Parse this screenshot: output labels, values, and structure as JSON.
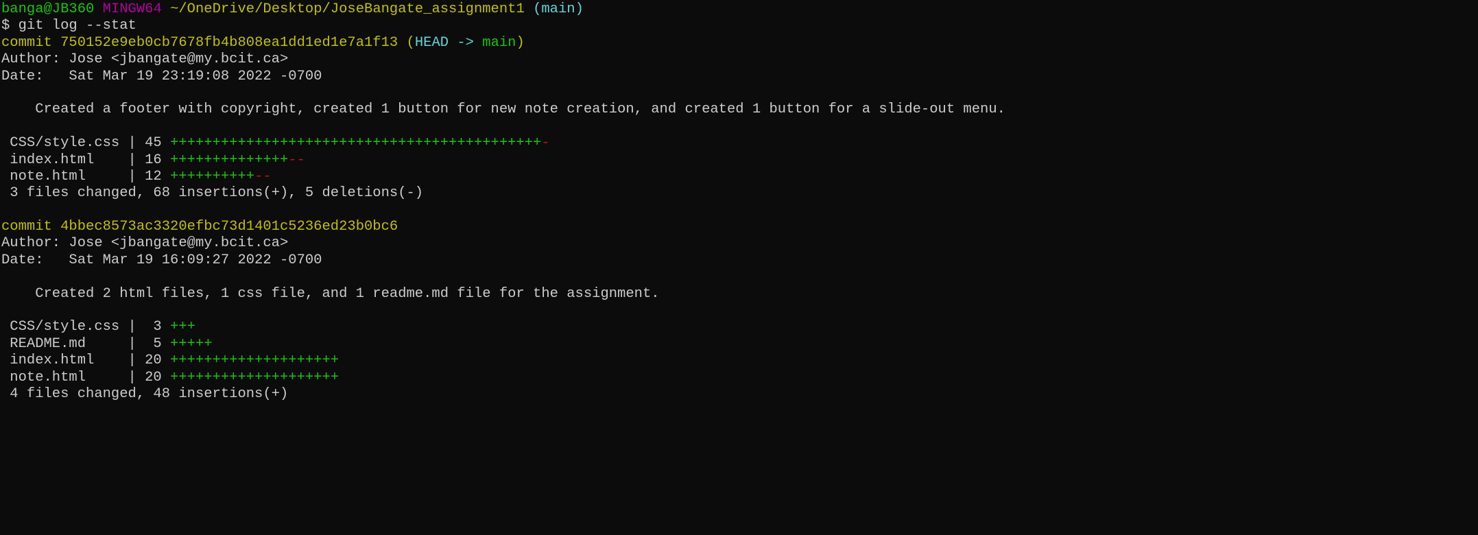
{
  "prompt": {
    "user_host": "banga@JB360",
    "system": "MINGW64",
    "path": "~/OneDrive/Desktop/JoseBangate_assignment1",
    "branch": "(main)"
  },
  "command": "$ git log --stat",
  "commits": [
    {
      "label": "commit",
      "hash": "750152e9eb0cb7678fb4b808ea1dd1ed1e7a1f13",
      "ref_open": "(",
      "ref_head": "HEAD ->",
      "ref_branch": "main",
      "ref_close": ")",
      "author": "Author: Jose <jbangate@my.bcit.ca>",
      "date": "Date:   Sat Mar 19 23:19:08 2022 -0700",
      "message": "    Created a footer with copyright, created 1 button for new note creation, and created 1 button for a slide-out menu.",
      "files": [
        {
          "name": " CSS/style.css | 45 ",
          "plus": "++++++++++++++++++++++++++++++++++++++++++++",
          "minus": "-"
        },
        {
          "name": " index.html    | 16 ",
          "plus": "++++++++++++++",
          "minus": "--"
        },
        {
          "name": " note.html     | 12 ",
          "plus": "++++++++++",
          "minus": "--"
        }
      ],
      "summary": " 3 files changed, 68 insertions(+), 5 deletions(-)"
    },
    {
      "label": "commit",
      "hash": "4bbec8573ac3320efbc73d1401c5236ed23b0bc6",
      "author": "Author: Jose <jbangate@my.bcit.ca>",
      "date": "Date:   Sat Mar 19 16:09:27 2022 -0700",
      "message": "    Created 2 html files, 1 css file, and 1 readme.md file for the assignment.",
      "files": [
        {
          "name": " CSS/style.css |  3 ",
          "plus": "+++",
          "minus": ""
        },
        {
          "name": " README.md     |  5 ",
          "plus": "+++++",
          "minus": ""
        },
        {
          "name": " index.html    | 20 ",
          "plus": "++++++++++++++++++++",
          "minus": ""
        },
        {
          "name": " note.html     | 20 ",
          "plus": "++++++++++++++++++++",
          "minus": ""
        }
      ],
      "summary": " 4 files changed, 48 insertions(+)"
    }
  ]
}
